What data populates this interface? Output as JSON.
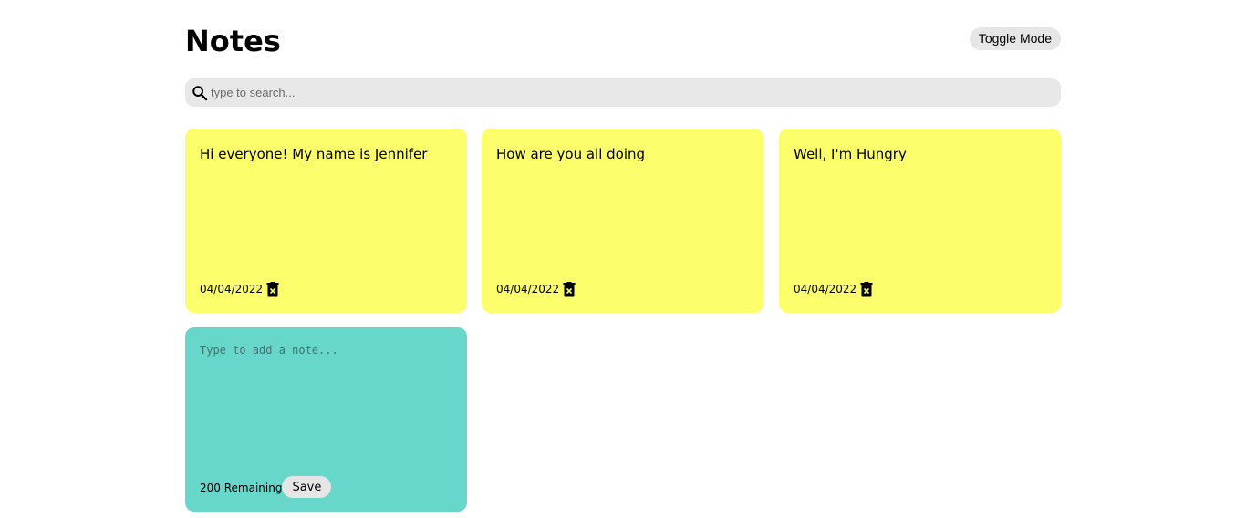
{
  "header": {
    "title": "Notes",
    "toggle_label": "Toggle Mode"
  },
  "search": {
    "placeholder": "type to search...",
    "value": "",
    "icon": "search-icon"
  },
  "notes": [
    {
      "text": "Hi everyone! My name is Jennifer",
      "date": "04/04/2022",
      "icon": "trash-icon"
    },
    {
      "text": "How are you all doing",
      "date": "04/04/2022",
      "icon": "trash-icon"
    },
    {
      "text": "Well, I'm Hungry",
      "date": "04/04/2022",
      "icon": "trash-icon"
    }
  ],
  "new_note": {
    "placeholder": "Type to add a note...",
    "value": "",
    "remaining": "200 Remaining",
    "save_label": "Save"
  },
  "colors": {
    "note_background": "#fdfe6c",
    "new_note_background": "#67d7cc",
    "search_background": "#e8e8e8",
    "button_background": "#e6e6e6"
  }
}
